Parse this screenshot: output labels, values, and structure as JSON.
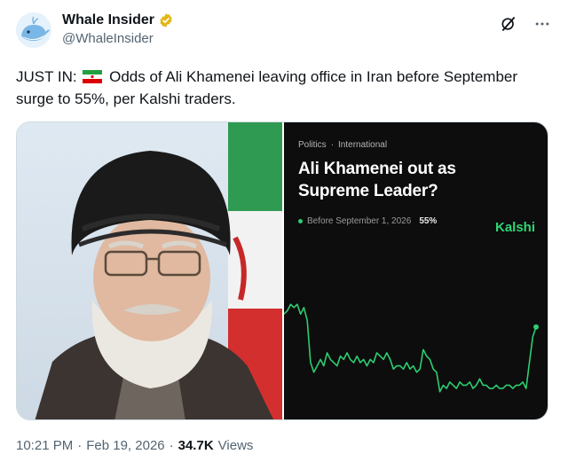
{
  "author": {
    "display_name": "Whale Insider",
    "handle": "@WhaleInsider",
    "verified": true,
    "avatar_icon": "whale-avatar-icon"
  },
  "header_icons": [
    "grok-icon",
    "more-icon"
  ],
  "tweet": {
    "prefix": "JUST IN:",
    "flag": "iran-flag-icon",
    "body": "Odds of Ali Khamenei leaving office in Iran before September surge to 55%, per Kalshi traders."
  },
  "card": {
    "crumbs": [
      "Politics",
      "·",
      "International"
    ],
    "title": "Ali Khamenei out as Supreme Leader?",
    "legend_label": "Before September 1, 2026",
    "legend_value": "55%",
    "brand": "Kalshi",
    "accent": "#2ecc71"
  },
  "chart_data": {
    "type": "line",
    "title": "Ali Khamenei out as Supreme Leader?",
    "series": [
      {
        "name": "Before September 1, 2026",
        "values": [
          29,
          30,
          32,
          31,
          32,
          29,
          31,
          27,
          14,
          11,
          13,
          15,
          13,
          17,
          15,
          14,
          13,
          16,
          15,
          17,
          15,
          14,
          16,
          14,
          15,
          13,
          15,
          14,
          17,
          16,
          15,
          17,
          15,
          12,
          13,
          13,
          12,
          14,
          12,
          13,
          11,
          12,
          18,
          16,
          15,
          12,
          11,
          5,
          7,
          6,
          8,
          7,
          6,
          8,
          7,
          7,
          8,
          6,
          7,
          9,
          7,
          7,
          6,
          6,
          7,
          6,
          6,
          7,
          7,
          6,
          7,
          7,
          8,
          6,
          14,
          22,
          25
        ]
      }
    ],
    "ylim": [
      0,
      40
    ],
    "grid": false,
    "legend_position": "top-left"
  },
  "meta": {
    "time": "10:21 PM",
    "sep1": "·",
    "date": "Feb 19, 2026",
    "sep2": "·",
    "views_count": "34.7K",
    "views_label": "Views"
  },
  "colors": {
    "text": "#0f1419",
    "secondary": "#536471",
    "verified_badge": "#e2b719",
    "chart_line": "#2ecc71",
    "card_bg": "#0d0d0d"
  }
}
